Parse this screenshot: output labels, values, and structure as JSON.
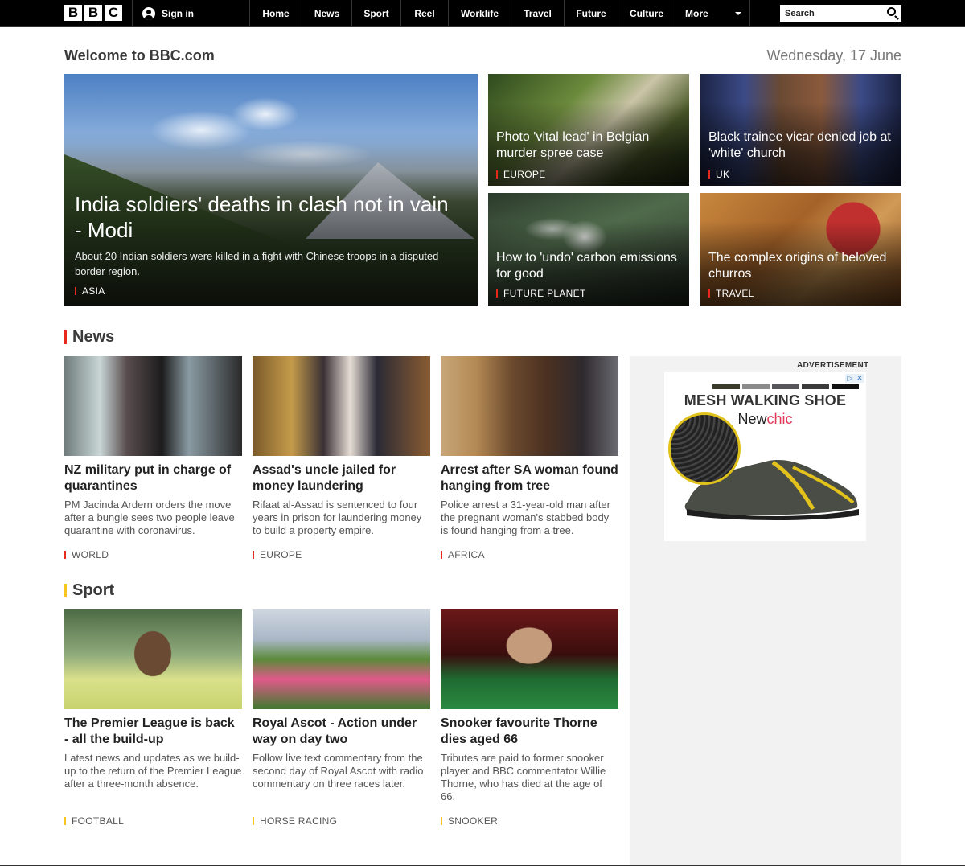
{
  "nav": {
    "logo_letters": [
      "B",
      "B",
      "C"
    ],
    "signin": "Sign in",
    "items": [
      "Home",
      "News",
      "Sport",
      "Reel",
      "Worklife",
      "Travel",
      "Future",
      "Culture"
    ],
    "more": "More",
    "search_placeholder": "Search"
  },
  "welcome": "Welcome to BBC.com",
  "date": "Wednesday, 17 June",
  "hero": {
    "main": {
      "title": "India soldiers' deaths in clash not in vain - Modi",
      "summary": "About 20 Indian soldiers were killed in a fight with Chinese troops in a disputed border region.",
      "tag": "ASIA"
    },
    "cards": [
      {
        "title": "Photo 'vital lead' in Belgian murder spree case",
        "tag": "EUROPE"
      },
      {
        "title": "Black trainee vicar denied job at 'white' church",
        "tag": "UK"
      },
      {
        "title": "How to 'undo' carbon emissions for good",
        "tag": "FUTURE PLANET"
      },
      {
        "title": "The complex origins of beloved churros",
        "tag": "TRAVEL"
      }
    ]
  },
  "news": {
    "heading": "News",
    "stories": [
      {
        "title": "NZ military put in charge of quarantines",
        "summary": "PM Jacinda Ardern orders the move after a bungle sees two people leave quarantine with coronavirus.",
        "tag": "WORLD"
      },
      {
        "title": "Assad's uncle jailed for money laundering",
        "summary": "Rifaat al-Assad is sentenced to four years in prison for laundering money to build a property empire.",
        "tag": "EUROPE"
      },
      {
        "title": "Arrest after SA woman found hanging from tree",
        "summary": "Police arrest a 31-year-old man after the pregnant woman's stabbed body is found hanging from a tree.",
        "tag": "AFRICA"
      }
    ]
  },
  "sport": {
    "heading": "Sport",
    "stories": [
      {
        "title": "The Premier League is back - all the build-up",
        "summary": "Latest news and updates as we build-up to the return of the Premier League after a three-month absence.",
        "tag": "FOOTBALL"
      },
      {
        "title": "Royal Ascot - Action under way on day two",
        "summary": "Follow live text commentary from the second day of Royal Ascot with radio commentary on three races later.",
        "tag": "HORSE RACING"
      },
      {
        "title": "Snooker favourite Thorne dies aged 66",
        "summary": "Tributes are paid to former snooker player and BBC commentator Willie Thorne, who has died at the age of 66.",
        "tag": "SNOOKER"
      }
    ]
  },
  "ad": {
    "label": "ADVERTISEMENT",
    "headline": "MESH WALKING SHOE",
    "brand_a": "New",
    "brand_b": "chic",
    "controls": [
      "▷",
      "✕"
    ]
  },
  "colors": {
    "news_accent": "#e6291b",
    "sport_accent": "#f6c51e",
    "topbar": "#000000"
  }
}
